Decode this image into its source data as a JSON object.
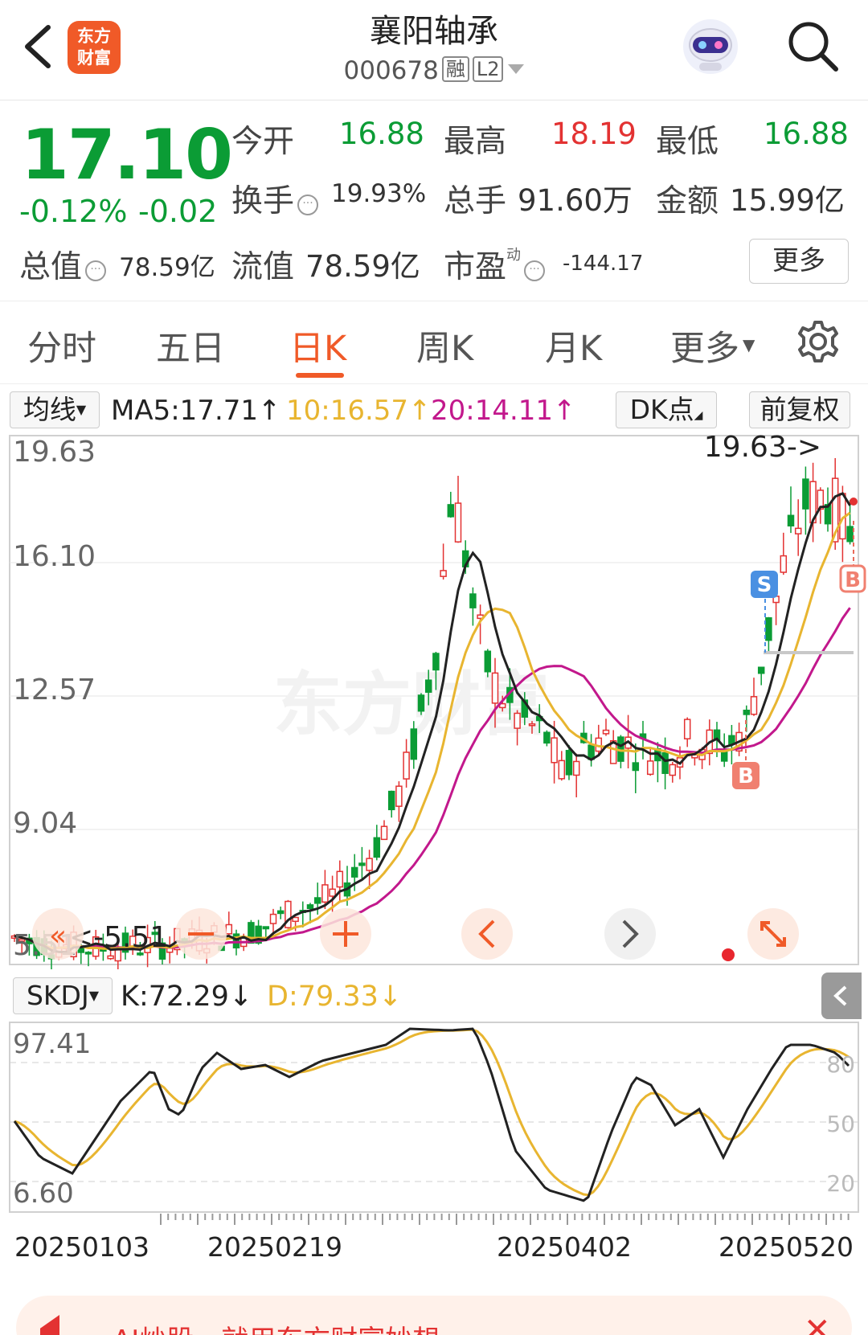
{
  "header": {
    "logo_text": "东方财富",
    "title": "襄阳轴承",
    "code": "000678",
    "tag_margin": "融",
    "tag_level": "L2"
  },
  "quote": {
    "price": "17.10",
    "change_pct": "-0.12%",
    "change_amt": "-0.02",
    "open_label": "今开",
    "open_value": "16.88",
    "high_label": "最高",
    "high_value": "18.19",
    "low_label": "最低",
    "low_value": "16.88",
    "turnover_label": "换手",
    "turnover_value": "19.93%",
    "volume_label": "总手",
    "volume_value": "91.60万",
    "amount_label": "金额",
    "amount_value": "15.99亿",
    "mktcap_label": "总值",
    "mktcap_value": "78.59亿",
    "float_label": "流值",
    "float_value": "78.59亿",
    "pe_label": "市盈",
    "pe_superscript": "动",
    "pe_value": "-144.17",
    "more_label": "更多"
  },
  "tabs": [
    "分时",
    "五日",
    "日K",
    "周K",
    "月K",
    "更多"
  ],
  "active_tab": "日K",
  "ma": {
    "selector": "均线",
    "ma5": "MA5:17.71↑",
    "ma10": "10:16.57↑",
    "ma20": "20:14.11↑",
    "dk_label": "DK点",
    "adjust_label": "前复权"
  },
  "kline_axis": {
    "labels": [
      "19.63",
      "16.10",
      "12.57",
      "9.04",
      "5.51"
    ],
    "max_annotation": "19.63->",
    "min_annotation": "<-5.51",
    "signal_s": "S",
    "signal_b": "B"
  },
  "kdj": {
    "selector": "SKDJ",
    "k": "K:72.29↓",
    "d": "D:79.33↓",
    "axis_top": "97.41",
    "axis_bottom": "6.60",
    "ref_80": "80",
    "ref_50": "50",
    "ref_20": "20"
  },
  "dates": [
    "20250103",
    "20250219",
    "20250402",
    "20250520"
  ],
  "banner": {
    "text": "AI炒股，就用东方财富妙想"
  },
  "colors": {
    "up": "#e33232",
    "down": "#0b9c35",
    "accent": "#f05a28",
    "ma10": "#e8b530",
    "ma20": "#c2188c"
  }
}
